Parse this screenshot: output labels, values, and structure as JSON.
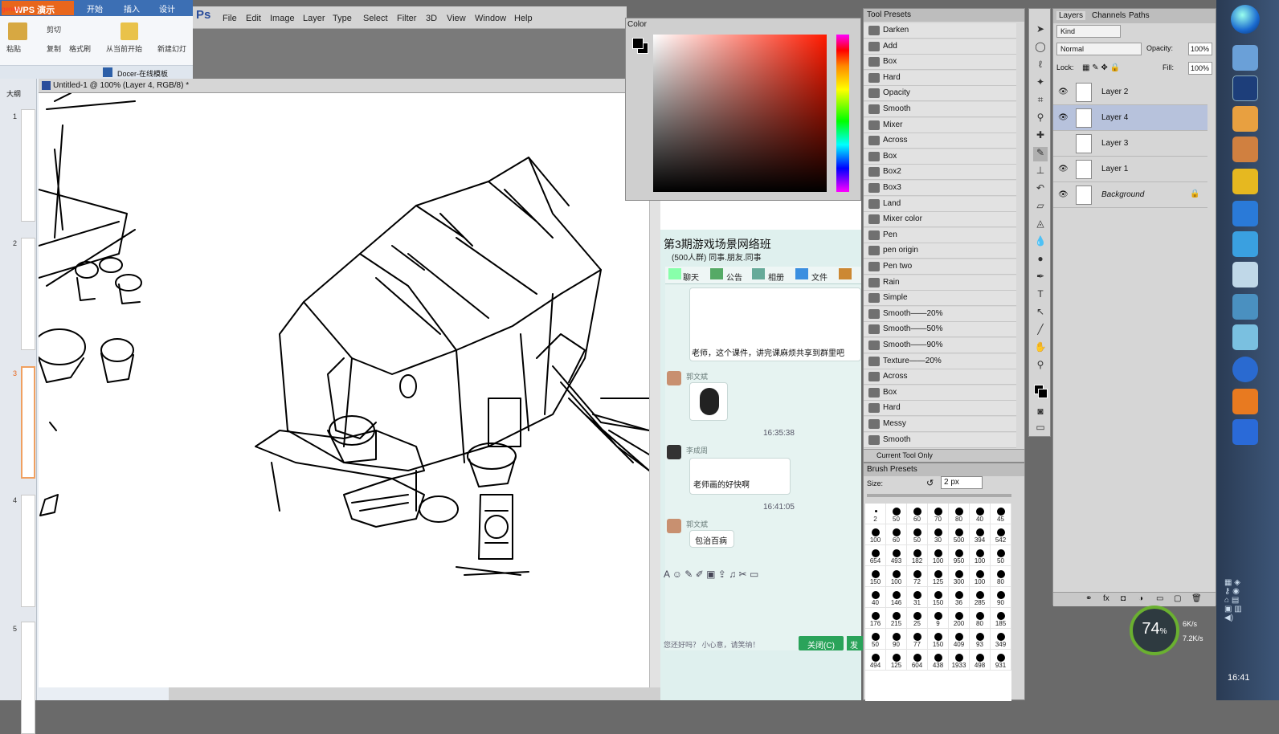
{
  "wps": {
    "app_label": "WPS 演示",
    "badge": "genius",
    "tabs": [
      "开始",
      "插入",
      "设计"
    ],
    "ribbon": {
      "paste": "粘贴",
      "cut": "剪切",
      "copy": "复制",
      "format_painter": "格式刷",
      "from_start": "从当前开始",
      "new_slide": "新建幻灯"
    },
    "docer": "Docer-在线模板",
    "outline_tab": "大纲",
    "slide_numbers": [
      "1",
      "2",
      "3",
      "4",
      "5"
    ]
  },
  "ps": {
    "logo": "Ps",
    "menu": [
      "File",
      "Edit",
      "Image",
      "Layer",
      "Type",
      "Select",
      "Filter",
      "3D",
      "View",
      "Window",
      "Help"
    ],
    "doc_title": "Untitled-1 @ 100% (Layer 4, RGB/8) *"
  },
  "color_panel": {
    "title": "Color"
  },
  "qq": {
    "group_title": "第3期游戏场景网络班",
    "group_sub": "(500人群) 同事.朋友.同事",
    "tabs": [
      "聊天",
      "公告",
      "相册",
      "文件"
    ],
    "messages": [
      {
        "text": "老师，这个课件，讲完课麻烦共享到群里吧"
      },
      {
        "name": "郭文斌"
      },
      {
        "time": "16:35:38"
      },
      {
        "name": "李成周",
        "text": "老师画的好快啊"
      },
      {
        "time": "16:41:05"
      },
      {
        "name": "郭文斌",
        "text": "包治百病"
      }
    ],
    "hint": "您还好吗？ 小心意，请笑纳！",
    "close_btn": "关闭(C)",
    "send_btn": "发"
  },
  "tool_presets": {
    "title": "Tool Presets",
    "items": [
      "Darken",
      "Add",
      "Box",
      "Hard",
      "Opacity",
      "Smooth",
      "Mixer",
      "Across",
      "Box",
      "Box2",
      "Box3",
      "Land",
      "Mixer color",
      "Pen",
      "pen origin",
      "Pen two",
      "Rain",
      "Simple",
      "Smooth——20%",
      "Smooth——50%",
      "Smooth——90%",
      "Texture——20%",
      "Across",
      "Box",
      "Hard",
      "Messy",
      "Smooth"
    ],
    "current_only": "Current Tool Only"
  },
  "brush_presets": {
    "title": "Brush Presets",
    "size_label": "Size:",
    "size_value": "2 px",
    "sizes": [
      "2",
      "50",
      "60",
      "70",
      "80",
      "40",
      "45",
      "100",
      "60",
      "50",
      "30",
      "500",
      "394",
      "542",
      "654",
      "493",
      "182",
      "100",
      "950",
      "100",
      "50",
      "150",
      "100",
      "72",
      "125",
      "300",
      "100",
      "80",
      "40",
      "146",
      "31",
      "150",
      "36",
      "285",
      "90",
      "176",
      "215",
      "25",
      "9",
      "200",
      "80",
      "185",
      "50",
      "90",
      "77",
      "150",
      "409",
      "93",
      "349",
      "494",
      "125",
      "604",
      "438",
      "1933",
      "498",
      "931"
    ]
  },
  "layers": {
    "tabs": [
      "Layers",
      "Channels",
      "Paths"
    ],
    "kind": "Kind",
    "blend": "Normal",
    "opacity_label": "Opacity:",
    "opacity": "100%",
    "lock_label": "Lock:",
    "fill_label": "Fill:",
    "fill": "100%",
    "items": [
      {
        "name": "Layer 2",
        "visible": true,
        "selected": false
      },
      {
        "name": "Layer 4",
        "visible": true,
        "selected": true
      },
      {
        "name": "Layer 3",
        "visible": false,
        "selected": false
      },
      {
        "name": "Layer 1",
        "visible": true,
        "selected": false
      },
      {
        "name": "Background",
        "visible": true,
        "selected": false
      }
    ]
  },
  "net_meter": {
    "percent": "74",
    "unit": "%",
    "up": "6K/s",
    "down": "7.2K/s"
  },
  "clock": "16:41"
}
